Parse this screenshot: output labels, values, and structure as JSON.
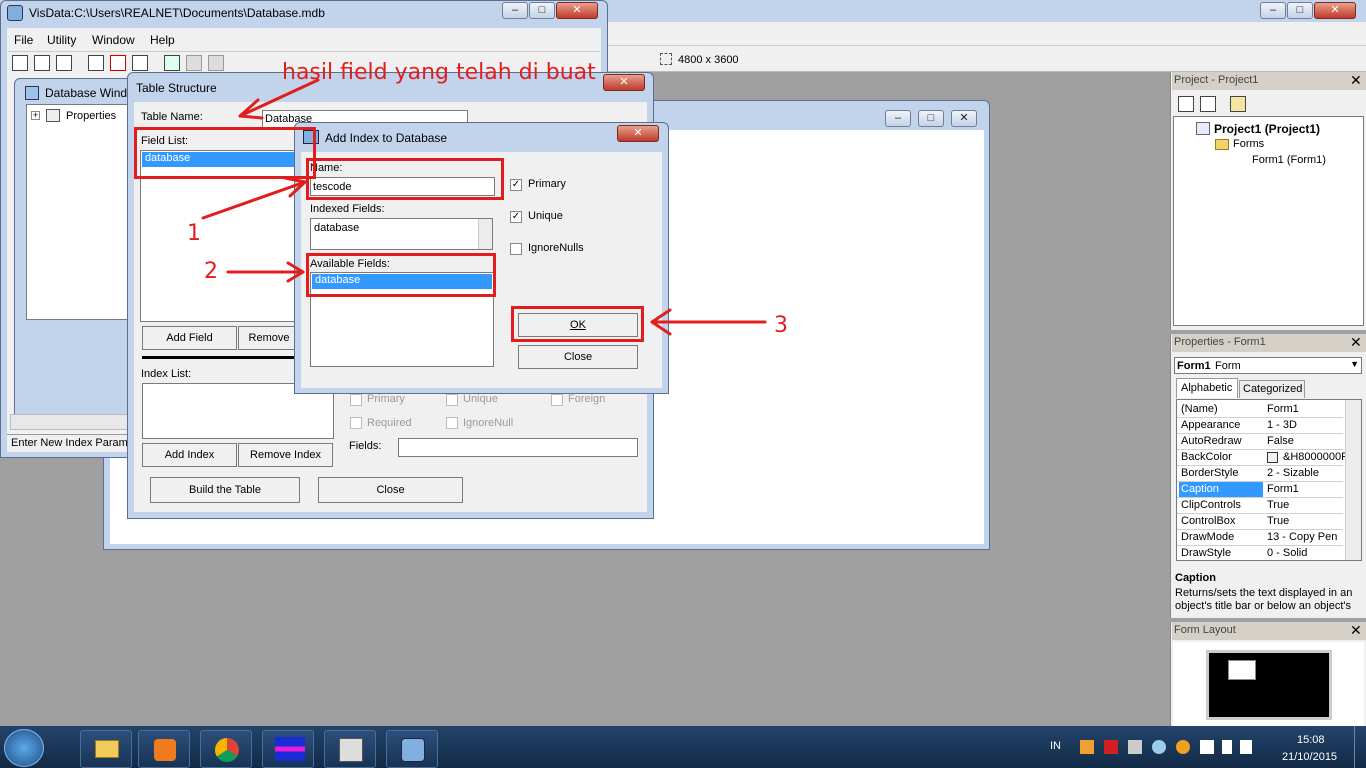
{
  "visdata": {
    "title": "VisData:C:\\Users\\REALNET\\Documents\\Database.mdb",
    "menu": [
      "File",
      "Utility",
      "Window",
      "Help"
    ],
    "status": "Enter New Index Param"
  },
  "db_window": {
    "title": "Database Windo",
    "tree_item": "Properties"
  },
  "vb": {
    "size_readout": "4800 x 3600"
  },
  "table_structure": {
    "title": "Table Structure",
    "table_name_label": "Table Name:",
    "table_name_value": "Database",
    "field_list_label": "Field List:",
    "field_list_items": [
      "database"
    ],
    "add_field": "Add Field",
    "remove_field": "Remove",
    "index_list_label": "Index List:",
    "add_index": "Add Index",
    "remove_index": "Remove Index",
    "build_table": "Build the Table",
    "close": "Close",
    "idx_primary": "Primary",
    "idx_unique": "Unique",
    "idx_foreign": "Foreign",
    "idx_required": "Required",
    "idx_ignorenull": "IgnoreNull",
    "fields_label": "Fields:"
  },
  "add_index": {
    "title": "Add Index to Database",
    "name_label": "Name:",
    "name_value": "tescode",
    "indexed_fields_label": "Indexed Fields:",
    "indexed_fields_value": "database",
    "available_fields_label": "Available Fields:",
    "available_fields": [
      "database"
    ],
    "primary": "Primary",
    "unique": "Unique",
    "ignore_nulls": "IgnoreNulls",
    "primary_checked": true,
    "unique_checked": true,
    "ignore_nulls_checked": false,
    "ok": "OK",
    "close": "Close"
  },
  "annotations": {
    "heading": "hasil field yang telah di buat",
    "n1": "1",
    "n2": "2",
    "n3": "3"
  },
  "project": {
    "title": "Project - Project1",
    "root": "Project1 (Project1)",
    "forms": "Forms",
    "form1": "Form1 (Form1)"
  },
  "properties": {
    "title": "Properties - Form1",
    "object": "Form1",
    "object_type": "Form",
    "tabs": [
      "Alphabetic",
      "Categorized"
    ],
    "rows": [
      {
        "name": "(Name)",
        "value": "Form1"
      },
      {
        "name": "Appearance",
        "value": "1 - 3D"
      },
      {
        "name": "AutoRedraw",
        "value": "False"
      },
      {
        "name": "BackColor",
        "value": "&H8000000F"
      },
      {
        "name": "BorderStyle",
        "value": "2 - Sizable"
      },
      {
        "name": "Caption",
        "value": "Form1"
      },
      {
        "name": "ClipControls",
        "value": "True"
      },
      {
        "name": "ControlBox",
        "value": "True"
      },
      {
        "name": "DrawMode",
        "value": "13 - Copy Pen"
      },
      {
        "name": "DrawStyle",
        "value": "0 - Solid"
      }
    ],
    "desc_title": "Caption",
    "desc_text": "Returns/sets the text displayed in an object's title bar or below an object's"
  },
  "form_layout": {
    "title": "Form Layout"
  },
  "taskbar": {
    "lang": "IN",
    "time": "15:08",
    "date": "21/10/2015"
  },
  "colors": {
    "annotation": "#e21d1d",
    "selection": "#3399ff"
  }
}
